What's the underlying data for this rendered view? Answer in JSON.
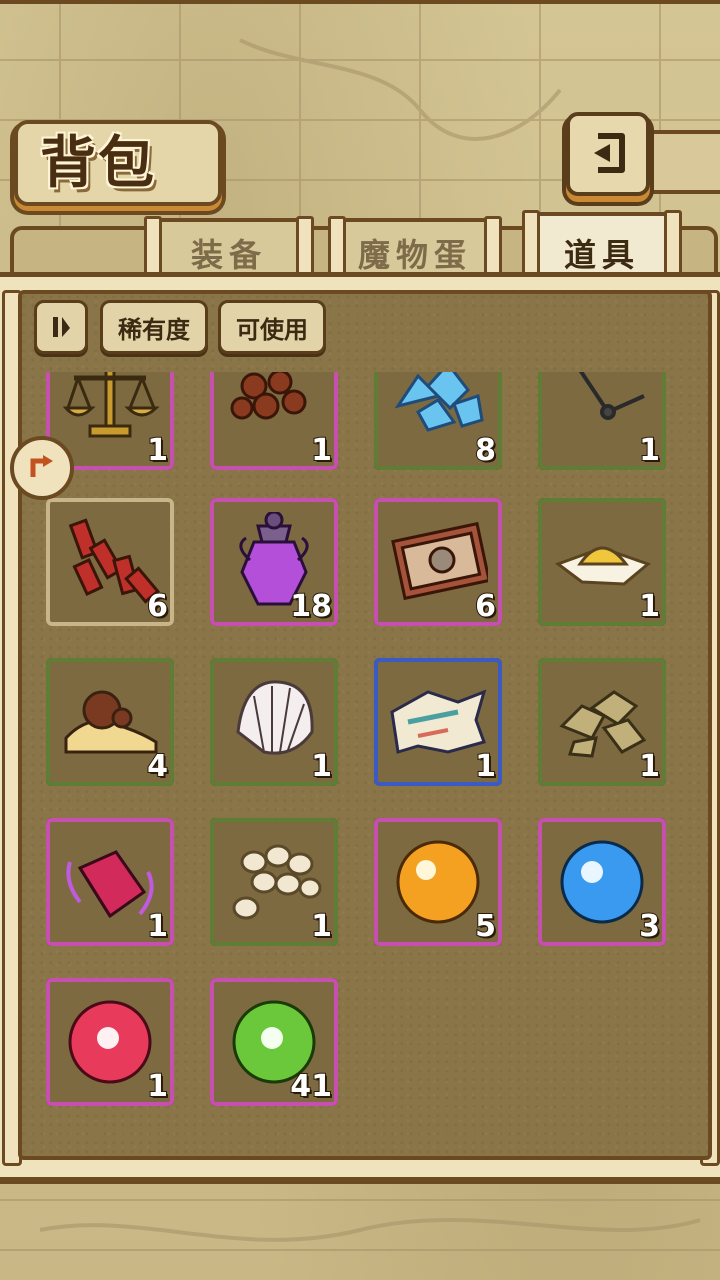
{
  "header": {
    "title": "背包",
    "back_icon": "back-arrow-icon"
  },
  "tabs": [
    {
      "label": "装备",
      "active": false
    },
    {
      "label": "魔物蛋",
      "active": false
    },
    {
      "label": "道具",
      "active": true
    }
  ],
  "filters": {
    "sort_icon": "sort-toggle-icon",
    "rarity_label": "稀有度",
    "usable_label": "可使用"
  },
  "colors": {
    "green": "#5f7d35",
    "pink": "#c64fb0",
    "blue": "#3a5bc4",
    "beige": "#c8b58a"
  },
  "items": [
    {
      "name": "scales",
      "qty": "1",
      "rarity": "pink"
    },
    {
      "name": "brown-beads",
      "qty": "1",
      "rarity": "pink"
    },
    {
      "name": "ice-crystals",
      "qty": "8",
      "rarity": "green"
    },
    {
      "name": "clock-hands",
      "qty": "1",
      "rarity": "green"
    },
    {
      "name": "firecrackers",
      "qty": "6",
      "rarity": "beige"
    },
    {
      "name": "purple-potion",
      "qty": "18",
      "rarity": "pink"
    },
    {
      "name": "ticket",
      "qty": "6",
      "rarity": "pink"
    },
    {
      "name": "powder-pile",
      "qty": "1",
      "rarity": "green"
    },
    {
      "name": "sand-dune",
      "qty": "4",
      "rarity": "green"
    },
    {
      "name": "shell",
      "qty": "1",
      "rarity": "green"
    },
    {
      "name": "torn-map",
      "qty": "1",
      "rarity": "blue"
    },
    {
      "name": "rocks",
      "qty": "1",
      "rarity": "green"
    },
    {
      "name": "red-crystal",
      "qty": "1",
      "rarity": "pink"
    },
    {
      "name": "seeds",
      "qty": "1",
      "rarity": "green"
    },
    {
      "name": "orange-orb",
      "qty": "5",
      "rarity": "pink"
    },
    {
      "name": "blue-orb",
      "qty": "3",
      "rarity": "pink"
    },
    {
      "name": "red-orb",
      "qty": "1",
      "rarity": "pink"
    },
    {
      "name": "green-orb",
      "qty": "41",
      "rarity": "pink"
    }
  ]
}
